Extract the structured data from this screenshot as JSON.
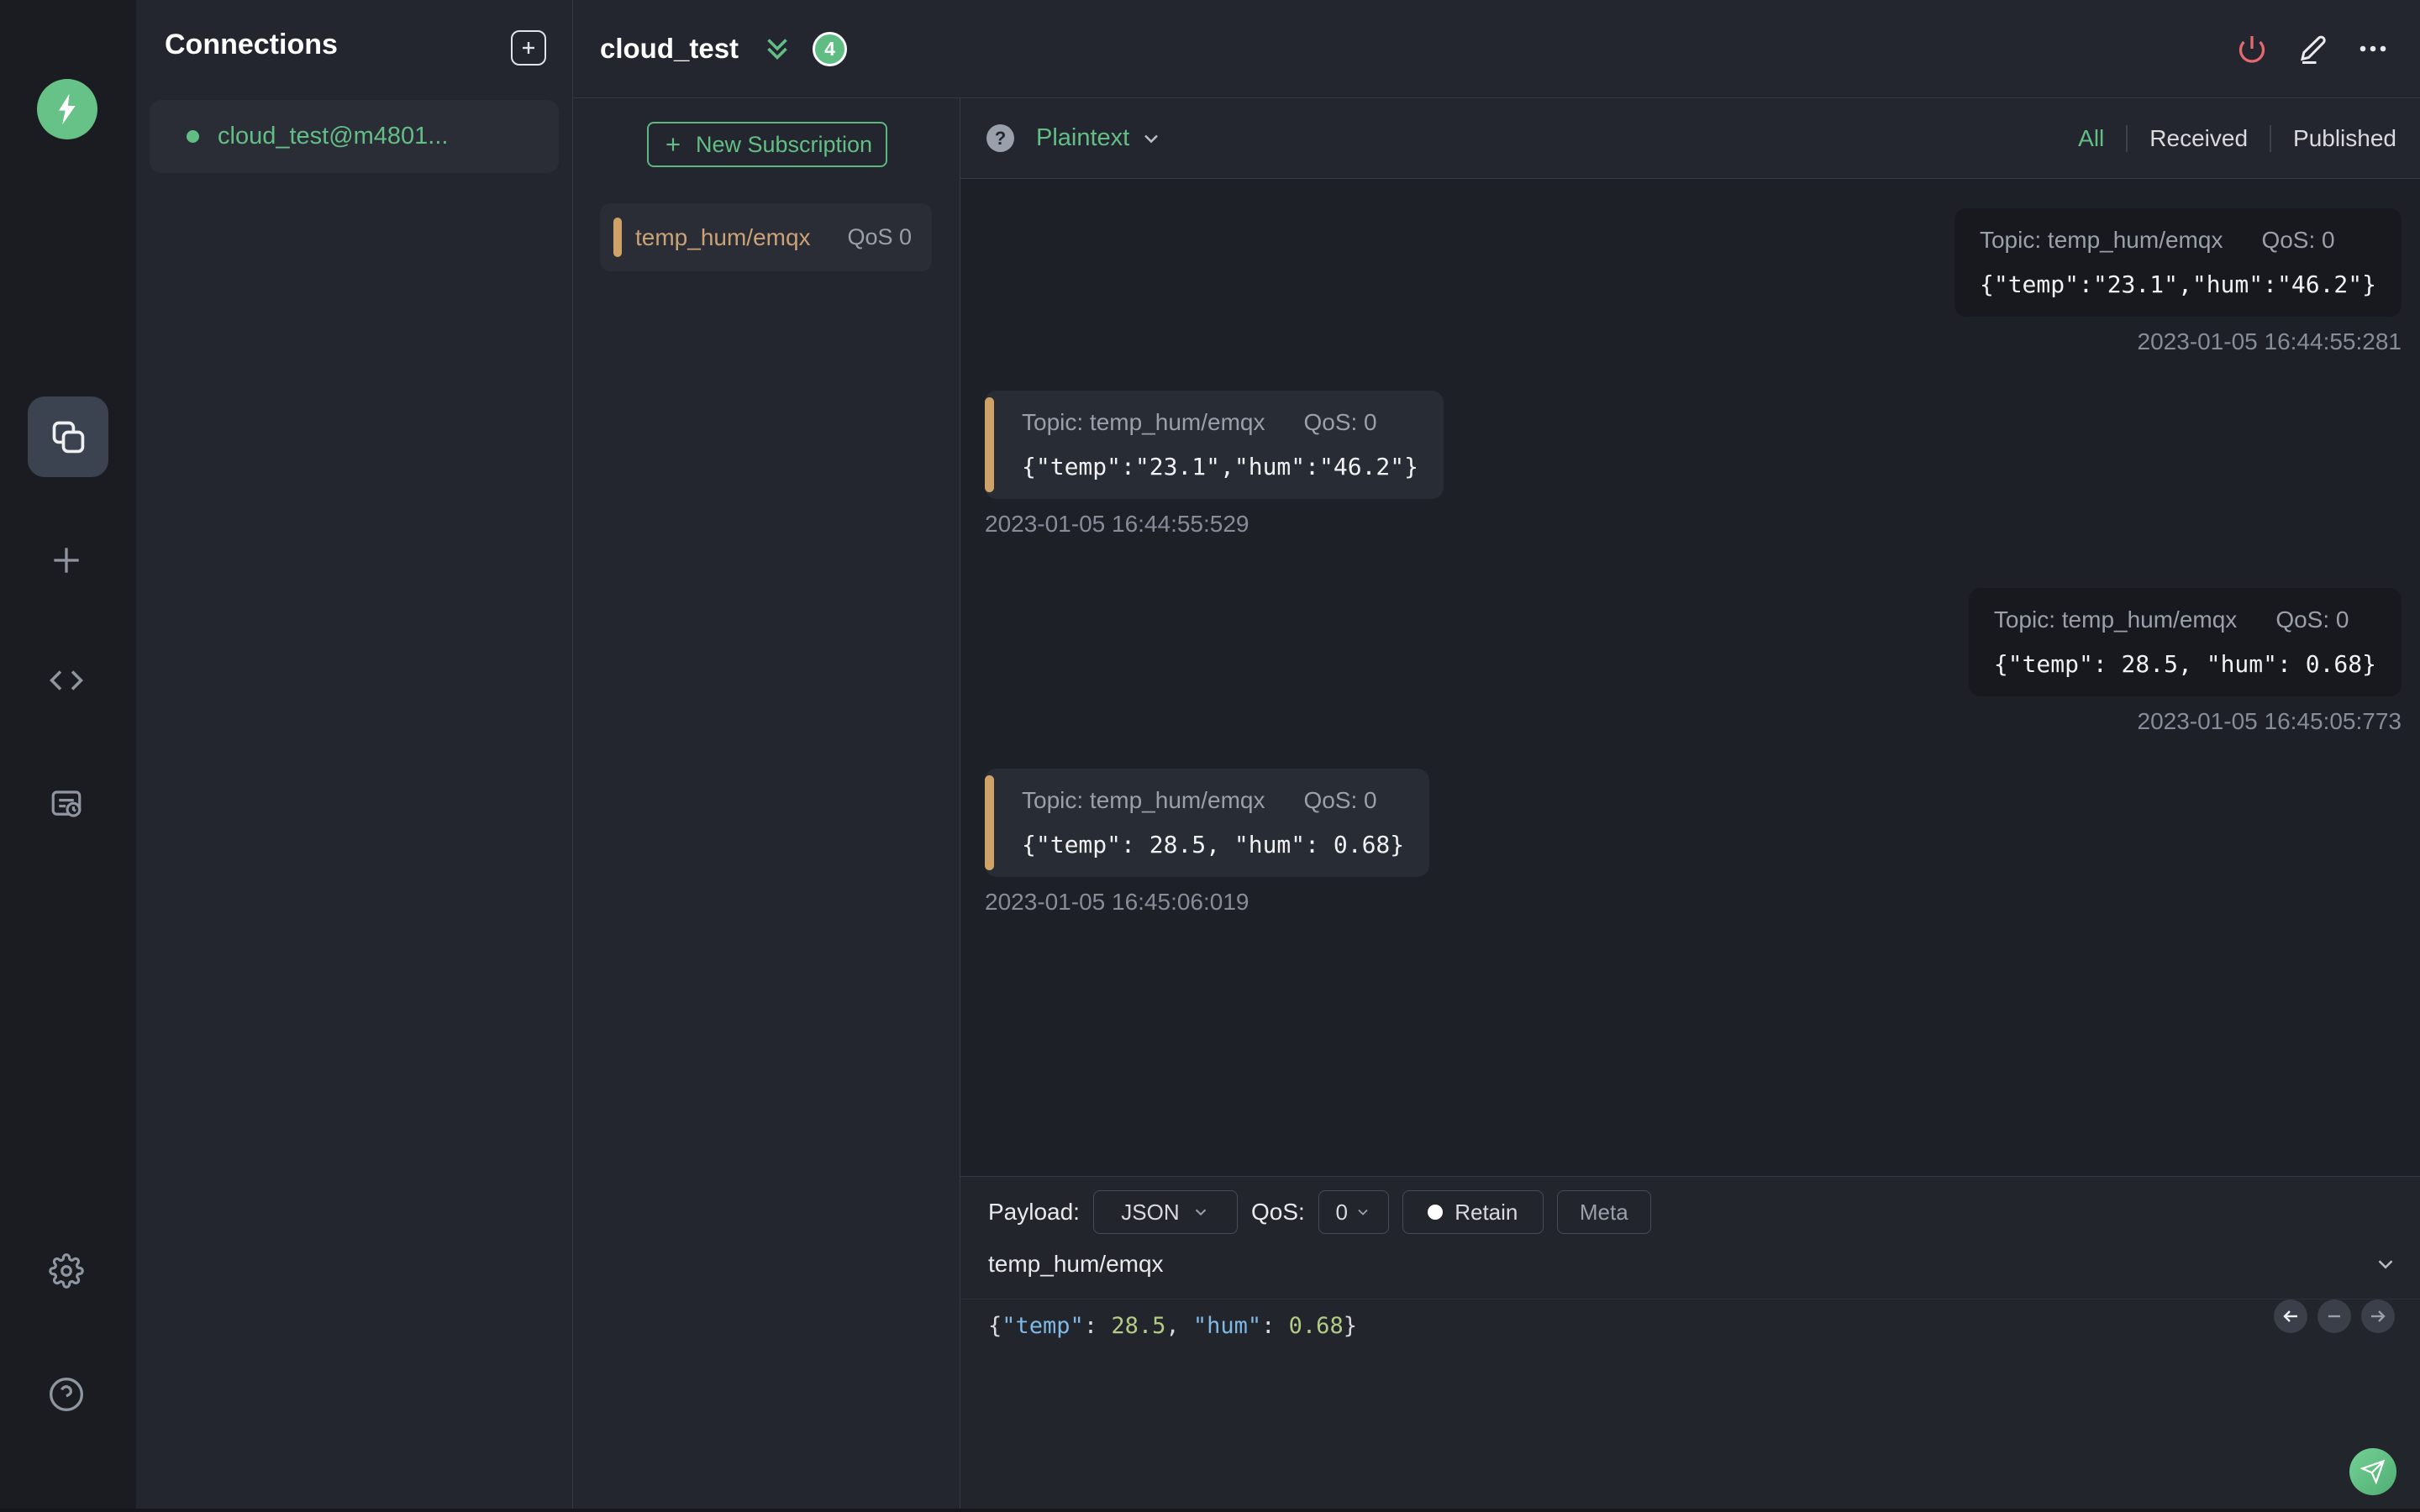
{
  "colors": {
    "accent_green": "#63be86",
    "accent_tan": "#cfa368",
    "danger_red": "#e2696f",
    "panel_bg": "#23262e",
    "list_bg": "#1d2027",
    "bubble_received": "#282c34",
    "bubble_published": "#17191f"
  },
  "rail": {
    "logo_icon": "mqttx-logo",
    "nav_icons": [
      "connections-icon",
      "new-connection-plus-icon",
      "script-code-icon",
      "log-icon"
    ],
    "footer_icons": [
      "settings-gear-icon",
      "help-circle-icon"
    ]
  },
  "connections": {
    "title": "Connections",
    "add_button_icon": "plus-icon",
    "items": [
      {
        "name": "cloud_test@m4801...",
        "status": "connected"
      }
    ]
  },
  "header": {
    "title": "cloud_test",
    "collapse_icon": "double-chevron-down-icon",
    "message_count_badge": "4",
    "action_icons": [
      "disconnect-power-icon",
      "edit-pencil-icon",
      "more-ellipsis-icon"
    ]
  },
  "subscriptions": {
    "new_button_label": "New Subscription",
    "items": [
      {
        "topic": "temp_hum/emqx",
        "qos": "QoS 0"
      }
    ]
  },
  "messages": {
    "format_selector": {
      "value": "Plaintext",
      "help_icon": "help-circle-badge",
      "caret_icon": "chevron-down-icon"
    },
    "filters": {
      "active": "All",
      "options": [
        "All",
        "Received",
        "Published"
      ]
    },
    "items": [
      {
        "direction": "published",
        "topic": "Topic: temp_hum/emqx",
        "qos": "QoS: 0",
        "payload": "{\"temp\":\"23.1\",\"hum\":\"46.2\"}",
        "timestamp": "2023-01-05 16:44:55:281"
      },
      {
        "direction": "received",
        "topic": "Topic: temp_hum/emqx",
        "qos": "QoS: 0",
        "payload": "{\"temp\":\"23.1\",\"hum\":\"46.2\"}",
        "timestamp": "2023-01-05 16:44:55:529"
      },
      {
        "direction": "published",
        "topic": "Topic: temp_hum/emqx",
        "qos": "QoS: 0",
        "payload": "{\"temp\": 28.5, \"hum\": 0.68}",
        "timestamp": "2023-01-05 16:45:05:773"
      },
      {
        "direction": "received",
        "topic": "Topic: temp_hum/emqx",
        "qos": "QoS: 0",
        "payload": "{\"temp\": 28.5, \"hum\": 0.68}",
        "timestamp": "2023-01-05 16:45:06:019"
      }
    ]
  },
  "publish": {
    "payload_label": "Payload:",
    "payload_format": "JSON",
    "qos_label": "QoS:",
    "qos_value": "0",
    "retain_label": "Retain",
    "meta_label": "Meta",
    "topic_value": "temp_hum/emqx",
    "payload_tokens": [
      {
        "t": "{"
      },
      {
        "t": "\"temp\""
      },
      {
        "t": ": "
      },
      {
        "t": "28.5"
      },
      {
        "t": ", "
      },
      {
        "t": "\"hum\""
      },
      {
        "t": ": "
      },
      {
        "t": "0.68"
      },
      {
        "t": "}"
      }
    ],
    "history_nav_icons": [
      "arrow-left-icon",
      "minus-icon",
      "arrow-right-icon"
    ],
    "send_icon": "send-paper-plane-icon"
  }
}
